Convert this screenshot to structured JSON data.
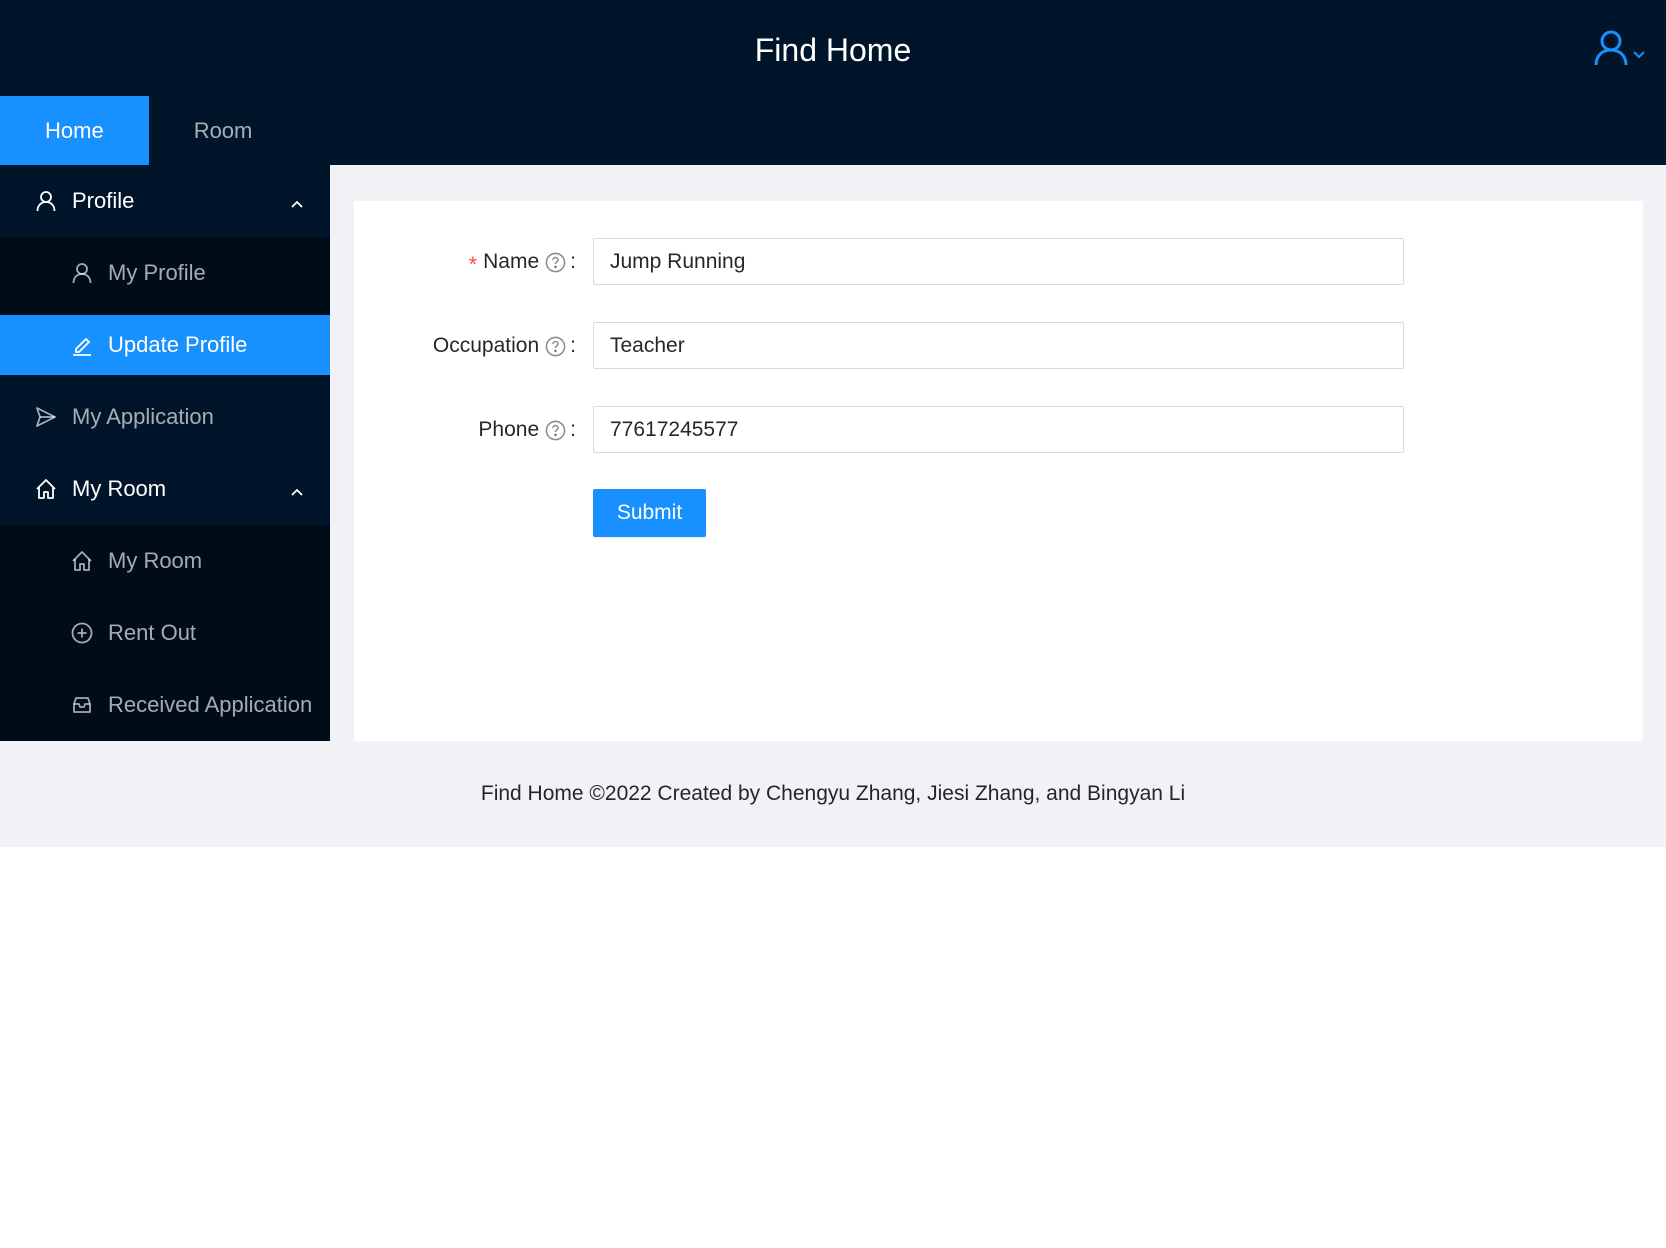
{
  "header": {
    "title": "Find Home",
    "user_icon": "user-icon",
    "dropdown_icon": "chevron-down-icon"
  },
  "top_nav": {
    "tabs": [
      {
        "label": "Home",
        "active": true
      },
      {
        "label": "Room",
        "active": false
      }
    ]
  },
  "sidebar": {
    "groups": [
      {
        "label": "Profile",
        "icon": "user-icon",
        "expanded": true,
        "items": [
          {
            "label": "My Profile",
            "icon": "user-icon",
            "selected": false
          },
          {
            "label": "Update Profile",
            "icon": "edit-icon",
            "selected": true
          }
        ]
      },
      {
        "label": "My Application",
        "icon": "send-icon",
        "items": []
      },
      {
        "label": "My Room",
        "icon": "home-icon",
        "expanded": true,
        "items": [
          {
            "label": "My Room",
            "icon": "home-icon",
            "selected": false
          },
          {
            "label": "Rent Out",
            "icon": "plus-circle-icon",
            "selected": false
          },
          {
            "label": "Received Application",
            "icon": "inbox-icon",
            "selected": false
          }
        ]
      }
    ]
  },
  "form": {
    "fields": [
      {
        "label": "Name",
        "required": true,
        "value": "Jump Running",
        "help_icon": "question-circle-icon"
      },
      {
        "label": "Occupation",
        "required": false,
        "value": "Teacher",
        "help_icon": "question-circle-icon"
      },
      {
        "label": "Phone",
        "required": false,
        "value": "77617245577",
        "help_icon": "question-circle-icon"
      }
    ],
    "colon": ":",
    "required_mark": "*",
    "submit_label": "Submit"
  },
  "footer": {
    "text": "Find Home ©2022 Created by Chengyu Zhang, Jiesi Zhang, and Bingyan Li"
  },
  "colors": {
    "primary": "#1890ff",
    "header_bg": "#001529",
    "submenu_bg": "#000c17",
    "layout_bg": "#f0f2f5",
    "required": "#ff4d4f"
  }
}
